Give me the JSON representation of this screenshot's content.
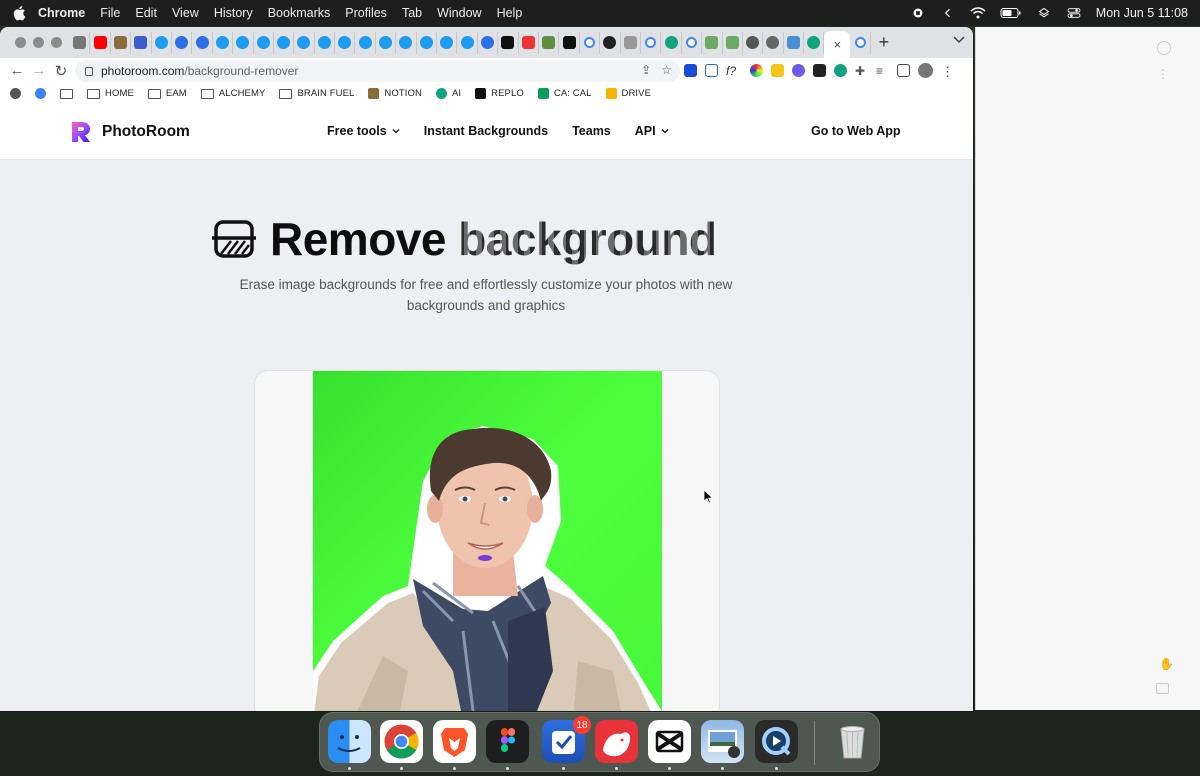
{
  "menubar": {
    "items": [
      "Chrome",
      "File",
      "Edit",
      "View",
      "History",
      "Bookmarks",
      "Profiles",
      "Tab",
      "Window",
      "Help"
    ],
    "datetime": "Mon Jun 5  11:08"
  },
  "browser": {
    "url_host": "photoroom.com",
    "url_path": "/background-remover",
    "active_tab_close": "×",
    "new_tab": "+",
    "tab_favicons": [
      "mute",
      "youtube",
      "photo",
      "pointer",
      "twitter",
      "threads",
      "threads",
      "twitter",
      "twitter",
      "twitter",
      "twitter",
      "twitter",
      "twitter",
      "twitter",
      "twitter",
      "twitter",
      "twitter",
      "twitter",
      "twitter",
      "twitter",
      "threads",
      "bold",
      "calendar",
      "shopify",
      "bold",
      "google",
      "mono",
      "cloud",
      "google",
      "chatgpt",
      "google",
      "wordle",
      "wordle",
      "bug",
      "globe",
      "s-app",
      "chatgpt",
      "active",
      "google"
    ],
    "bookmarks": [
      {
        "label": "",
        "icon": "globe-icon"
      },
      {
        "label": "",
        "icon": "drop-icon"
      },
      {
        "label": "",
        "icon": "folder-icon"
      },
      {
        "label": "HOME",
        "icon": "folder-icon"
      },
      {
        "label": "EAM",
        "icon": "folder-icon"
      },
      {
        "label": "ALCHEMY",
        "icon": "folder-icon"
      },
      {
        "label": "BRAIN FUEL",
        "icon": "folder-icon"
      },
      {
        "label": "NOTION",
        "icon": "image-icon"
      },
      {
        "label": "AI",
        "icon": "chatgpt-icon"
      },
      {
        "label": "REPLO",
        "icon": "replo-icon"
      },
      {
        "label": "CA: CAL",
        "icon": "sheets-icon"
      },
      {
        "label": "DRIVE",
        "icon": "drive-icon"
      }
    ]
  },
  "site": {
    "brand": "PhotoRoom",
    "nav": {
      "free_tools": "Free tools",
      "instant_backgrounds": "Instant Backgrounds",
      "teams": "Teams",
      "api": "API",
      "web_app": "Go to Web App"
    },
    "hero": {
      "title_a": "Remove",
      "title_b": "background",
      "subtitle": "Erase image backgrounds for free and effortlessly customize your photos with new backgrounds and graphics"
    },
    "colors": {
      "photo_bg": "#45f53a",
      "page_bg": "#eeeff3"
    }
  },
  "dock": {
    "apps": [
      "Finder",
      "Chrome",
      "Brave",
      "Figma",
      "Tasks",
      "Bear",
      "CapCut",
      "Preview",
      "QuickTime",
      "Trash"
    ],
    "badge": "18"
  }
}
